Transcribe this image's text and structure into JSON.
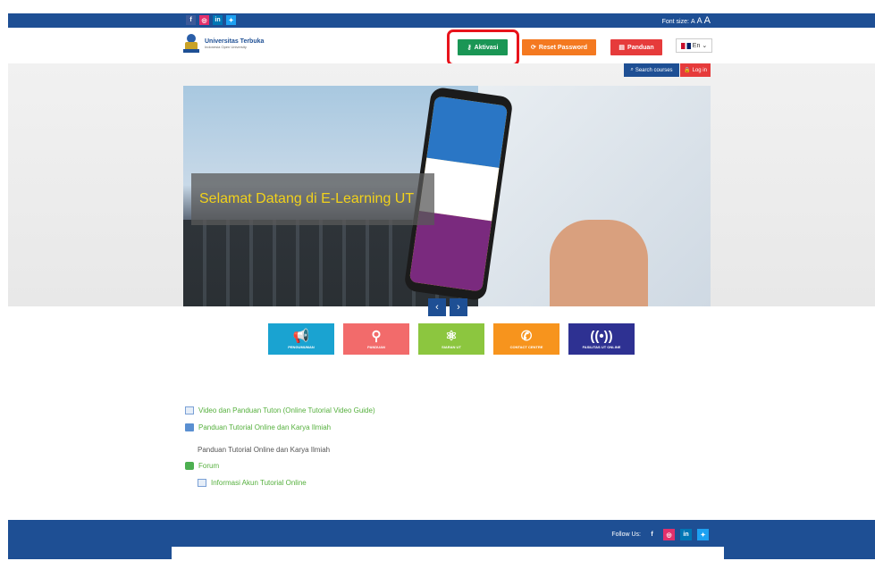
{
  "topbar": {
    "social": [
      {
        "icon": "facebook-icon",
        "glyph": "f",
        "color": "#3b5998"
      },
      {
        "icon": "instagram-icon",
        "glyph": "◎",
        "color": "#e1306c"
      },
      {
        "icon": "linkedin-icon",
        "glyph": "in",
        "color": "#0077b5"
      },
      {
        "icon": "twitter-icon",
        "glyph": "✦",
        "color": "#1da1f2"
      }
    ],
    "font_size_label": "Font size:",
    "font_small": "A",
    "font_medium": "A",
    "font_large": "A"
  },
  "header": {
    "logo_title": "Universitas Terbuka",
    "logo_subtitle": "Indonesia Open University",
    "aktivasi_label": "Aktivasi",
    "reset_label": "Reset Password",
    "panduan_label": "Panduan",
    "lang_label": "En",
    "search_label": "Search courses",
    "login_label": "Log in"
  },
  "slider": {
    "caption": "Selamat Datang di E-Learning UT",
    "prev": "‹",
    "next": "›"
  },
  "tiles": [
    {
      "label": "PENGUMUMAN",
      "icon": "megaphone-icon",
      "glyph": "📢",
      "color": "#1aa3d1"
    },
    {
      "label": "PANDUAN",
      "icon": "location-pin-icon",
      "glyph": "⚲",
      "color": "#f26b6b"
    },
    {
      "label": "SIARAN UT",
      "icon": "network-icon",
      "glyph": "⚛",
      "color": "#8cc63f"
    },
    {
      "label": "CONTACT CENTRE",
      "icon": "phone-icon",
      "glyph": "✆",
      "color": "#f7941d"
    },
    {
      "label": "FASILITAS UT ONLINE",
      "icon": "broadcast-icon",
      "glyph": "((•))",
      "color": "#2e3192"
    }
  ],
  "links": {
    "video": "Video dan Panduan Tuton (Online Tutorial Video Guide)",
    "panduan_folder": "Panduan Tutorial Online dan Karya Ilmiah",
    "panduan_text": "Panduan Tutorial Online dan Karya Ilmiah",
    "forum": "Forum",
    "informasi": "Informasi Akun Tutorial Online"
  },
  "footer": {
    "follow_label": "Follow Us:",
    "social": [
      {
        "icon": "facebook-icon",
        "glyph": "f",
        "color": "#3b5998"
      },
      {
        "icon": "instagram-icon",
        "glyph": "◎",
        "color": "#e1306c"
      },
      {
        "icon": "linkedin-icon",
        "glyph": "in",
        "color": "#0077b5"
      },
      {
        "icon": "twitter-icon",
        "glyph": "✦",
        "color": "#1da1f2"
      }
    ]
  },
  "colors": {
    "brand_blue": "#1e4f94",
    "highlight_red": "#e8131b",
    "link_green": "#56b03e"
  }
}
